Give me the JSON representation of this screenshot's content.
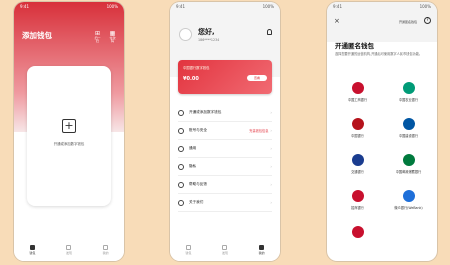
{
  "screen1": {
    "status_time": "9:41",
    "status_right": "100%",
    "title": "添加钱包",
    "icon_labels": [
      "扫一扫",
      "付款码"
    ],
    "card_label": "开通或添加数字钱包",
    "tabs": [
      "钱包",
      "发现",
      "我的"
    ]
  },
  "screen2": {
    "status_time": "9:41",
    "status_right": "100%",
    "greeting": "您好,",
    "phone": "186****1234",
    "card_label": "中国银行数字钱包",
    "card_amount": "¥0.00",
    "card_button": "查看",
    "menu": [
      {
        "label": "开通或添加数字钱包",
        "sub": ""
      },
      {
        "label": "账号与安全",
        "sub": "完善钱包信息"
      },
      {
        "label": "通用",
        "sub": ""
      },
      {
        "label": "隐私",
        "sub": ""
      },
      {
        "label": "帮助与反馈",
        "sub": ""
      },
      {
        "label": "关于我们",
        "sub": ""
      }
    ],
    "tabs": [
      "钱包",
      "发现",
      "我的"
    ]
  },
  "screen3": {
    "status_time": "9:41",
    "status_right": "100%",
    "close": "×",
    "link": "开通匿名钱包",
    "help": "?",
    "title": "开通匿名钱包",
    "desc": "选择您要开通的运营机构,开通后可使用数字人民币钱包功能。",
    "banks": [
      {
        "name": "中国工商银行",
        "color": "#c8102e"
      },
      {
        "name": "中国农业银行",
        "color": "#009b77"
      },
      {
        "name": "中国银行",
        "color": "#b5121b"
      },
      {
        "name": "中国建设银行",
        "color": "#0056a3"
      },
      {
        "name": "交通银行",
        "color": "#1a3c8f"
      },
      {
        "name": "中国邮政储蓄银行",
        "color": "#007a3d"
      },
      {
        "name": "招商银行",
        "color": "#c8102e"
      },
      {
        "name": "微众银行(WeBank)",
        "color": "#1e6fd9"
      },
      {
        "name": "",
        "color": "#c8102e"
      }
    ]
  }
}
